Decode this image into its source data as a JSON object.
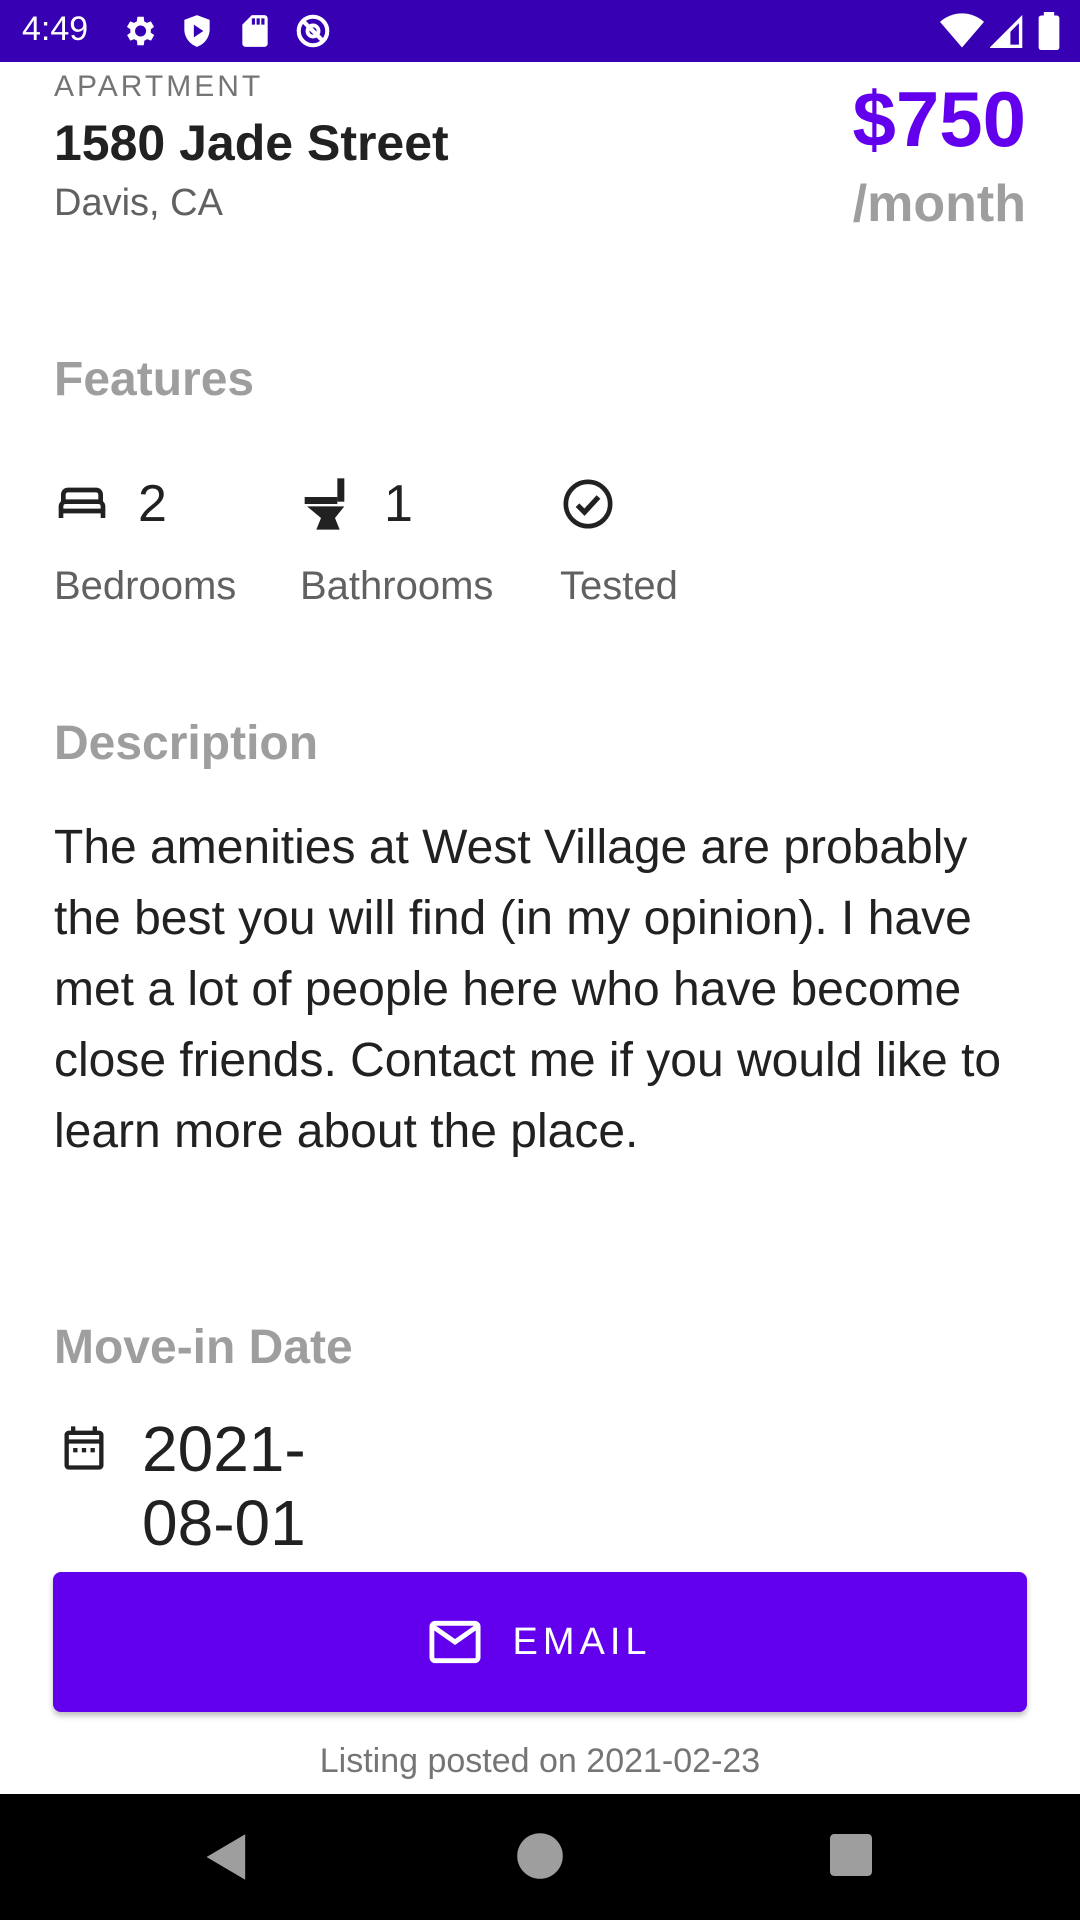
{
  "status_bar": {
    "time": "4:49",
    "bg_color": "#3700b3",
    "left_icons": [
      "settings-icon",
      "shield-play-icon",
      "sd-card-icon",
      "at-sign-icon"
    ],
    "right_icons": [
      "wifi-icon",
      "signal-icon",
      "battery-icon"
    ]
  },
  "listing": {
    "type": "APARTMENT",
    "address": "1580 Jade Street",
    "city": "Davis, CA",
    "price": "$750",
    "per": "/month",
    "accent_color": "#6200ee"
  },
  "features": {
    "title": "Features",
    "items": [
      {
        "icon": "bed-icon",
        "count": "2",
        "label": "Bedrooms"
      },
      {
        "icon": "toilet-icon",
        "count": "1",
        "label": "Bathrooms"
      },
      {
        "icon": "check-circle-icon",
        "count": "",
        "label": "Tested"
      }
    ]
  },
  "description": {
    "title": "Description",
    "text": "The amenities at West Village are probably the best you will find (in my opinion). I have met a lot of people here who have become close friends. Contact me if you would like to learn more about the place."
  },
  "move_in": {
    "title": "Move-in Date",
    "icon": "calendar-icon",
    "date": "2021-08-01"
  },
  "email_button": {
    "icon": "mail-icon",
    "label": "EMAIL"
  },
  "posted": "Listing posted on 2021-02-23",
  "nav_bar": {
    "buttons": [
      "back-icon",
      "home-icon",
      "recents-icon"
    ]
  }
}
